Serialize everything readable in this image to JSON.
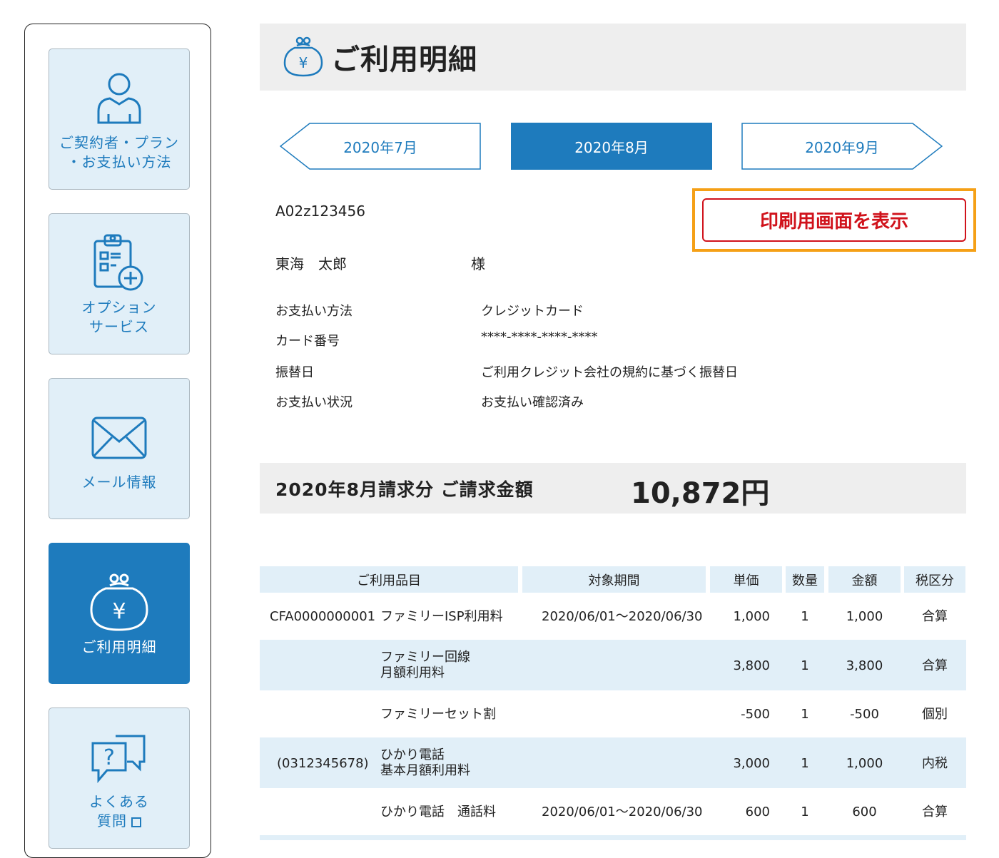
{
  "sidebar": {
    "items": [
      {
        "label_line1": "ご契約者・プラン",
        "label_line2": "・お支払い方法",
        "icon": "person-icon"
      },
      {
        "label_line1": "オプション",
        "label_line2": "サービス",
        "icon": "clipboard-plus-icon"
      },
      {
        "label_line1": "メール情報",
        "icon": "mail-icon"
      },
      {
        "label_line1": "ご利用明細",
        "icon": "yen-purse-icon",
        "active": true
      },
      {
        "label_line1": "よくある",
        "label_line2": "質問",
        "icon": "question-chat-icon"
      }
    ]
  },
  "header": {
    "title": "ご利用明細",
    "icon": "yen-purse-icon"
  },
  "months": {
    "prev": "2020年7月",
    "current": "2020年8月",
    "next": "2020年9月"
  },
  "account": {
    "id": "A02z123456",
    "name": "東海　太郎",
    "honorific": "様"
  },
  "print_button": "印刷用画面を表示",
  "info": [
    {
      "label": "お支払い方法",
      "value": "クレジットカード"
    },
    {
      "label": "カード番号",
      "value": "****-****-****-****"
    },
    {
      "label": "振替日",
      "value": "ご利用クレジット会社の規約に基づく振替日"
    },
    {
      "label": "お支払い状況",
      "value": "お支払い確認済み"
    }
  ],
  "billing": {
    "label": "2020年8月請求分 ご請求金額",
    "amount": "10,872円"
  },
  "table": {
    "headers": [
      "ご利用品目",
      "対象期間",
      "単価",
      "数量",
      "金額",
      "税区分"
    ],
    "rows": [
      {
        "code": "CFA0000000001",
        "item1": "ファミリーISP利用料",
        "item2": "",
        "period": "2020/06/01～2020/06/30",
        "price": "1,000",
        "qty": "1",
        "amount": "1,000",
        "tax": "合算"
      },
      {
        "code": "",
        "item1": "ファミリー回線",
        "item2": "月額利用料",
        "period": "",
        "price": "3,800",
        "qty": "1",
        "amount": "3,800",
        "tax": "合算"
      },
      {
        "code": "",
        "item1": "ファミリーセット割",
        "item2": "",
        "period": "",
        "price": "-500",
        "qty": "1",
        "amount": "-500",
        "tax": "個別"
      },
      {
        "code": "(0312345678)",
        "item1": "ひかり電話",
        "item2": "基本月額利用料",
        "period": "",
        "price": "3,000",
        "qty": "1",
        "amount": "1,000",
        "tax": "内税"
      },
      {
        "code": "",
        "item1": "ひかり電話　通話料",
        "item2": "",
        "period": "2020/06/01～2020/06/30",
        "price": "600",
        "qty": "1",
        "amount": "600",
        "tax": "合算"
      }
    ]
  },
  "colors": {
    "accent": "#1e7bbd",
    "light": "#e1eff8",
    "alert": "#d0121b",
    "highlight": "#f5a016"
  }
}
